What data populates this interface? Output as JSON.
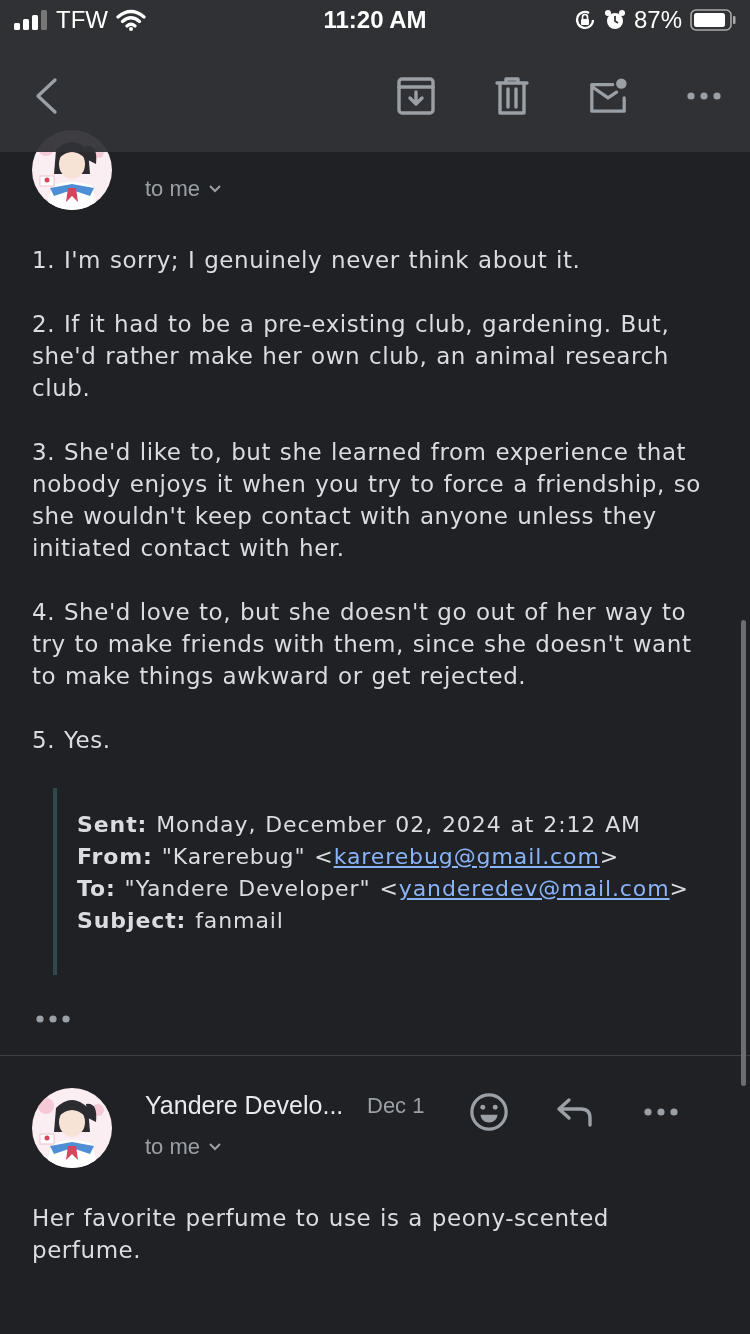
{
  "status_bar": {
    "carrier": "TFW",
    "time": "11:20 AM",
    "battery": "87%"
  },
  "messages": [
    {
      "actions": false,
      "recipient": "to me",
      "paragraphs": [
        "1. I'm sorry; I genuinely never think about it.",
        "2. If it had to be a pre-existing club, gardening. But, she'd rather make her own club, an animal research club.",
        "3. She'd like to, but she learned from experience that nobody enjoys it when you try to force a friendship, so she wouldn't keep contact with anyone unless they initiated contact with her.",
        "4. She'd love to, but she doesn't go out of her way to try to make friends with them, since she doesn't want to make things awkward or get rejected.",
        "5. Yes."
      ],
      "quote": [
        {
          "label": "Sent:",
          "text": "Monday, December 02, 2024 at 2:12 AM"
        },
        {
          "label": "From:",
          "text": "\"Karerebug\" <",
          "link": "karerebug@gmail.com",
          "after": ">"
        },
        {
          "label": "To:",
          "text": "\"Yandere Developer\" <",
          "link": "yanderedev@mail.com",
          "after": ">"
        },
        {
          "label": "Subject:",
          "text": "fanmail"
        }
      ]
    },
    {
      "actions": true,
      "sender": "Yandere Develo...",
      "date": "Dec 1",
      "recipient": "to me",
      "paragraphs": [
        "Her favorite perfume to use is a peony-scented perfume."
      ]
    }
  ]
}
